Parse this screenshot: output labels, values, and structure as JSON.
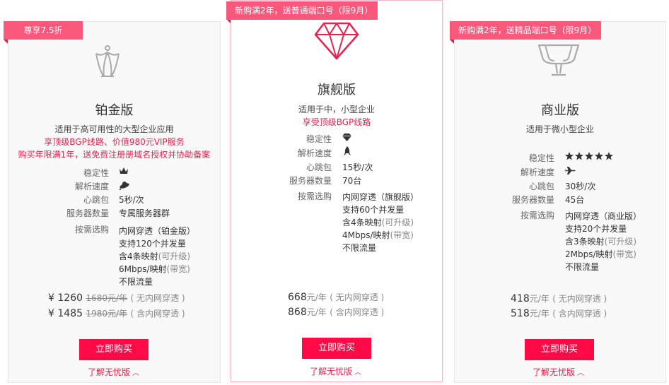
{
  "plans": [
    {
      "badge": "尊享7.5折",
      "icon": "crown-icon",
      "name": "铂金版",
      "desc": "适用于高可用性的大型企业应用",
      "highlights": [
        "享顶级BGP线路、价值980元VIP服务",
        "购买年限满1年，送免费注册册域名授权并协助备案"
      ],
      "specs": [
        {
          "label": "稳定性",
          "icon": "crown-small-icon"
        },
        {
          "label": "解析速度",
          "icon": "ufo-icon"
        },
        {
          "label": "心跳包",
          "value": "5秒/次"
        },
        {
          "label": "服务器数量",
          "value": "专属服务器群"
        }
      ],
      "ondemand_label": "按需选购",
      "ondemand": [
        {
          "text": "内网穿透（铂金版）",
          "extra": ""
        },
        {
          "text": "支持120个并发量",
          "extra": ""
        },
        {
          "text": "含4条映射",
          "extra": "(可升级)"
        },
        {
          "text": "6Mbps/映射",
          "extra": "(带宽)"
        },
        {
          "text": "不限流量",
          "extra": ""
        }
      ],
      "prices": [
        {
          "currency": "¥",
          "value": "1260",
          "unit": "",
          "old": "1680元/年",
          "note": "( 无内网穿透 )"
        },
        {
          "currency": "¥",
          "value": "1485",
          "unit": "",
          "old": "1980元/年",
          "note": "( 含内网穿透 )"
        }
      ],
      "buy_label": "立即购买",
      "more_label": "了解无忧版"
    },
    {
      "badge": "新购满2年，送普通端口号（限9月）",
      "icon": "diamond-icon",
      "name": "旗舰版",
      "desc": "适用于中，小型企业",
      "highlights": [
        "享受顶级BGP线路"
      ],
      "specs": [
        {
          "label": "稳定性",
          "icon": "diamond-small-icon"
        },
        {
          "label": "解析速度",
          "icon": "rocket-icon"
        },
        {
          "label": "心跳包",
          "value": "15秒/次"
        },
        {
          "label": "服务器数量",
          "value": "70台"
        }
      ],
      "ondemand_label": "按需选购",
      "ondemand": [
        {
          "text": "内网穿透（旗舰版）",
          "extra": ""
        },
        {
          "text": "支持60个并发量",
          "extra": ""
        },
        {
          "text": "含4条映射",
          "extra": "(可升级)"
        },
        {
          "text": "4Mbps/映射",
          "extra": "(带宽)"
        },
        {
          "text": "不限流量",
          "extra": ""
        }
      ],
      "prices": [
        {
          "currency": "",
          "value": "668",
          "unit": "元/年",
          "old": "",
          "note": "( 无内网穿透 )"
        },
        {
          "currency": "",
          "value": "868",
          "unit": "元/年",
          "old": "",
          "note": "( 含内网穿透 )"
        }
      ],
      "buy_label": "立即购买",
      "more_label": "了解无忧版"
    },
    {
      "badge": "新购满2年，送精品端口号（限9月）",
      "icon": "trophy-icon",
      "name": "商业版",
      "desc": "适用于微小型企业",
      "highlights": [],
      "specs": [
        {
          "label": "稳定性",
          "icon": "five-stars-icon"
        },
        {
          "label": "解析速度",
          "icon": "airplane-icon"
        },
        {
          "label": "心跳包",
          "value": "30秒/次"
        },
        {
          "label": "服务器数量",
          "value": "45台"
        }
      ],
      "ondemand_label": "按需选购",
      "ondemand": [
        {
          "text": "内网穿透（商业版）",
          "extra": ""
        },
        {
          "text": "支持20个并发量",
          "extra": ""
        },
        {
          "text": "含3条映射",
          "extra": "(可升级)"
        },
        {
          "text": "2Mbps/映射",
          "extra": "(带宽)"
        },
        {
          "text": "不限流量",
          "extra": ""
        }
      ],
      "prices": [
        {
          "currency": "",
          "value": "418",
          "unit": "元/年",
          "old": "",
          "note": "( 无内网穿透 )"
        },
        {
          "currency": "",
          "value": "518",
          "unit": "元/年",
          "old": "",
          "note": "( 含内网穿透 )"
        }
      ],
      "buy_label": "立即购买",
      "more_label": "了解无忧版"
    }
  ],
  "colors": {
    "accent": "#ff0a47",
    "badge": "#f7587c",
    "highlight_text": "#e8224f"
  }
}
